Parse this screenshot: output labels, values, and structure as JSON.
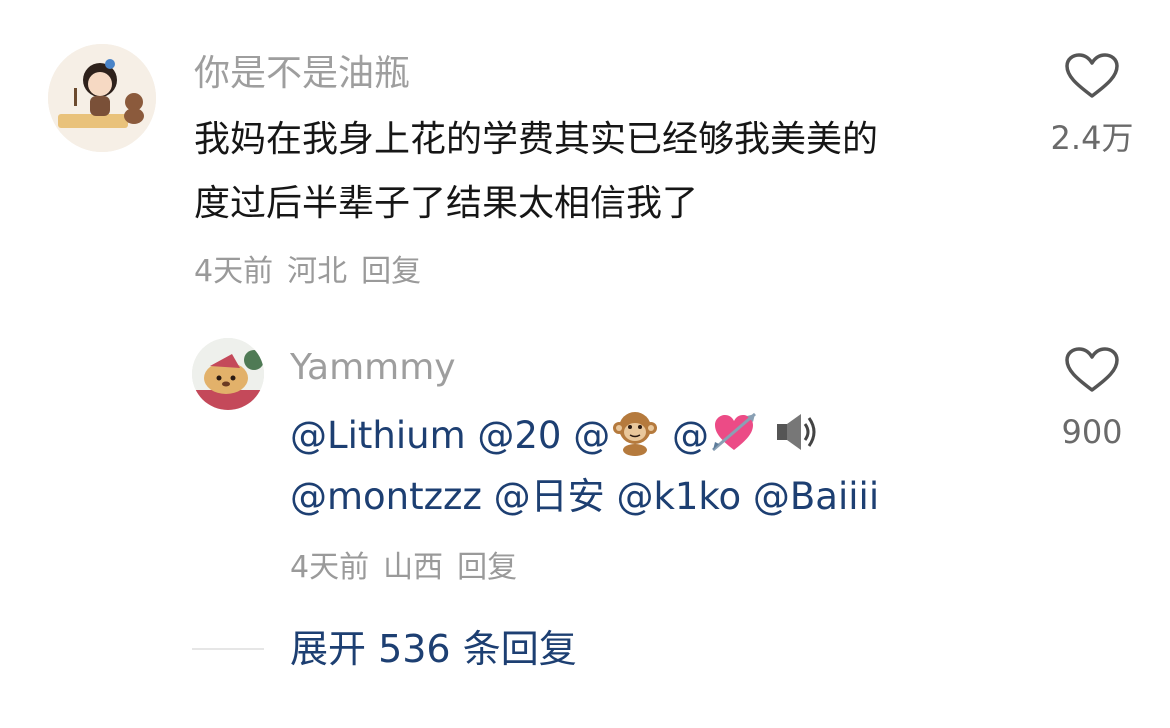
{
  "comment": {
    "username": "你是不是油瓶",
    "text_line1": "我妈在我身上花的学费其实已经够我美美的",
    "text_line2": "度过后半辈子了结果太相信我了",
    "time": "4天前",
    "location": "河北",
    "reply_label": "回复",
    "likes": "2.4万"
  },
  "reply": {
    "username": "Yammmy",
    "mentions_line1": [
      "@Lithium",
      "@20",
      "@",
      "@"
    ],
    "mentions_line2": [
      "@montzzz",
      "@日安",
      "@k1ko",
      "@Baiiii"
    ],
    "emoji_icons": [
      "monkey-emoji-icon",
      "heart-arrow-emoji-icon",
      "speaker-emoji-icon"
    ],
    "time": "4天前",
    "location": "山西",
    "reply_label": "回复",
    "likes": "900"
  },
  "expand_label": "展开 536 条回复",
  "colors": {
    "mention": "#1d3f72",
    "meta": "#9a9a9a",
    "username": "#9e9e9e",
    "body_text": "#161616"
  }
}
